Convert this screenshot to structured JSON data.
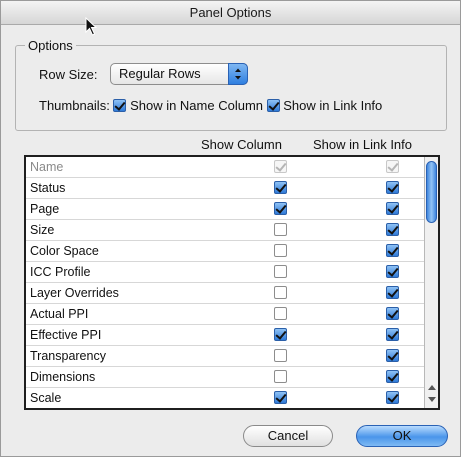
{
  "dialog": {
    "title": "Panel Options"
  },
  "options": {
    "legend": "Options",
    "row_size_label": "Row Size:",
    "row_size_value": "Regular Rows",
    "thumbnails_label": "Thumbnails:",
    "show_in_name_column": {
      "label": "Show in Name Column",
      "checked": true
    },
    "show_in_link_info": {
      "label": "Show in Link Info",
      "checked": true
    }
  },
  "table": {
    "headers": {
      "show_column": "Show Column",
      "show_in_link_info": "Show in Link Info"
    },
    "rows": [
      {
        "label": "Name",
        "show_column": true,
        "show_link_info": true,
        "disabled": true
      },
      {
        "label": "Status",
        "show_column": true,
        "show_link_info": true
      },
      {
        "label": "Page",
        "show_column": true,
        "show_link_info": true
      },
      {
        "label": "Size",
        "show_column": false,
        "show_link_info": true
      },
      {
        "label": "Color Space",
        "show_column": false,
        "show_link_info": true
      },
      {
        "label": "ICC Profile",
        "show_column": false,
        "show_link_info": true
      },
      {
        "label": "Layer Overrides",
        "show_column": false,
        "show_link_info": true
      },
      {
        "label": "Actual PPI",
        "show_column": false,
        "show_link_info": true
      },
      {
        "label": "Effective PPI",
        "show_column": true,
        "show_link_info": true
      },
      {
        "label": "Transparency",
        "show_column": false,
        "show_link_info": true
      },
      {
        "label": "Dimensions",
        "show_column": false,
        "show_link_info": true
      },
      {
        "label": "Scale",
        "show_column": true,
        "show_link_info": true
      }
    ]
  },
  "buttons": {
    "cancel": "Cancel",
    "ok": "OK"
  }
}
